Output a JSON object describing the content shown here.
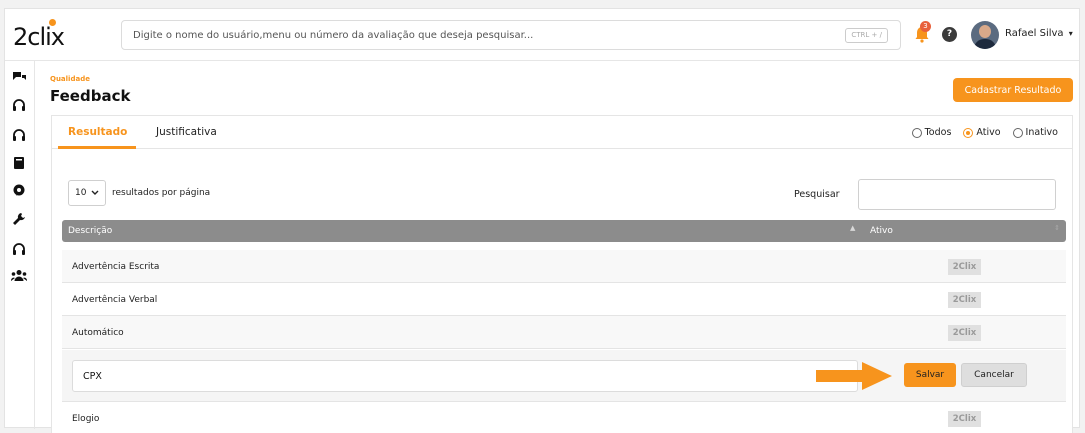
{
  "app": {
    "logo_text": "2clix"
  },
  "search": {
    "placeholder": "Digite o nome do usuário,menu ou número da avaliação que deseja pesquisar...",
    "shortcut": "CTRL + /"
  },
  "header": {
    "notification_count": "3",
    "help_label": "?",
    "user_name": "Rafael Silva",
    "user_caret": "▾"
  },
  "sidebar": {
    "icons": [
      "chat-icon",
      "headset-icon",
      "headset-icon",
      "book-icon",
      "brain-icon",
      "wrench-icon",
      "headset-icon",
      "users-icon"
    ]
  },
  "page": {
    "breadcrumb": "Qualidade",
    "title": "Feedback",
    "primary_button": "Cadastrar Resultado"
  },
  "tabs": [
    {
      "label": "Resultado"
    },
    {
      "label": "Justificativa"
    }
  ],
  "filters": {
    "options": [
      {
        "label": "Todos",
        "selected": false
      },
      {
        "label": "Ativo",
        "selected": true
      },
      {
        "label": "Inativo",
        "selected": false
      }
    ]
  },
  "table_controls": {
    "per_page_value": "10",
    "per_page_label": "resultados por página",
    "search_label": "Pesquisar"
  },
  "table": {
    "headers": [
      "Descrição",
      "Ativo"
    ],
    "rows": [
      {
        "description": "Advertência Escrita",
        "tag": "2Clix"
      },
      {
        "description": "Advertência Verbal",
        "tag": "2Clix"
      },
      {
        "description": "Automático",
        "tag": "2Clix"
      },
      {
        "description": "Elogio",
        "tag": "2Clix"
      }
    ]
  },
  "edit_row": {
    "value": "CPX",
    "save_label": "Salvar",
    "cancel_label": "Cancelar"
  },
  "colors": {
    "accent": "#f7941d",
    "header_bg": "#8c8c8c"
  }
}
